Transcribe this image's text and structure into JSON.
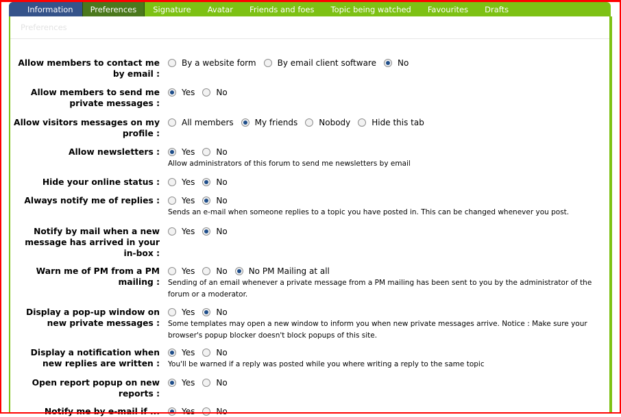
{
  "tabs": [
    {
      "label": "Information"
    },
    {
      "label": "Preferences"
    },
    {
      "label": "Signature"
    },
    {
      "label": "Avatar"
    },
    {
      "label": "Friends and foes"
    },
    {
      "label": "Topic being watched"
    },
    {
      "label": "Favourites"
    },
    {
      "label": "Drafts"
    }
  ],
  "section_title": "Preferences",
  "rows": [
    {
      "label": "Allow members to contact me by email :",
      "options": [
        "By a website form",
        "By email client software",
        "No"
      ],
      "selected": 2,
      "help": ""
    },
    {
      "label": "Allow members to send me private messages :",
      "options": [
        "Yes",
        "No"
      ],
      "selected": 0,
      "help": ""
    },
    {
      "label": "Allow visitors messages on my profile :",
      "options": [
        "All members",
        "My friends",
        "Nobody",
        "Hide this tab"
      ],
      "selected": 1,
      "help": ""
    },
    {
      "label": "Allow newsletters :",
      "options": [
        "Yes",
        "No"
      ],
      "selected": 0,
      "help": "Allow administrators of this forum to send me newsletters by email"
    },
    {
      "label": "Hide your online status :",
      "options": [
        "Yes",
        "No"
      ],
      "selected": 1,
      "help": ""
    },
    {
      "label": "Always notify me of replies :",
      "options": [
        "Yes",
        "No"
      ],
      "selected": 1,
      "help": "Sends an e-mail when someone replies to a topic you have posted in. This can be changed whenever you post."
    },
    {
      "label": "Notify by mail when a new message has arrived in your in-box :",
      "options": [
        "Yes",
        "No"
      ],
      "selected": 1,
      "help": ""
    },
    {
      "label": "Warn me of PM from a PM mailing :",
      "options": [
        "Yes",
        "No",
        "No PM Mailing at all"
      ],
      "selected": 2,
      "help": "Sending of an email whenever a private message from a PM mailing has been sent to you by the administrator of the forum or a moderator."
    },
    {
      "label": "Display a pop-up window on new private messages :",
      "options": [
        "Yes",
        "No"
      ],
      "selected": 1,
      "help": "Some templates may open a new window to inform you when new private messages arrive. Notice : Make sure your browser's popup blocker doesn't block popups of this site."
    },
    {
      "label": "Display a notification when new replies are written :",
      "options": [
        "Yes",
        "No"
      ],
      "selected": 0,
      "help": "You'll be warned if a reply was posted while you where writing a reply to the same topic"
    },
    {
      "label": "Open report popup on new reports :",
      "options": [
        "Yes",
        "No"
      ],
      "selected": 0,
      "help": ""
    },
    {
      "label": "Notify me by e-mail if ...",
      "options": [
        "Yes",
        "No"
      ],
      "selected": 0,
      "help": ""
    }
  ]
}
